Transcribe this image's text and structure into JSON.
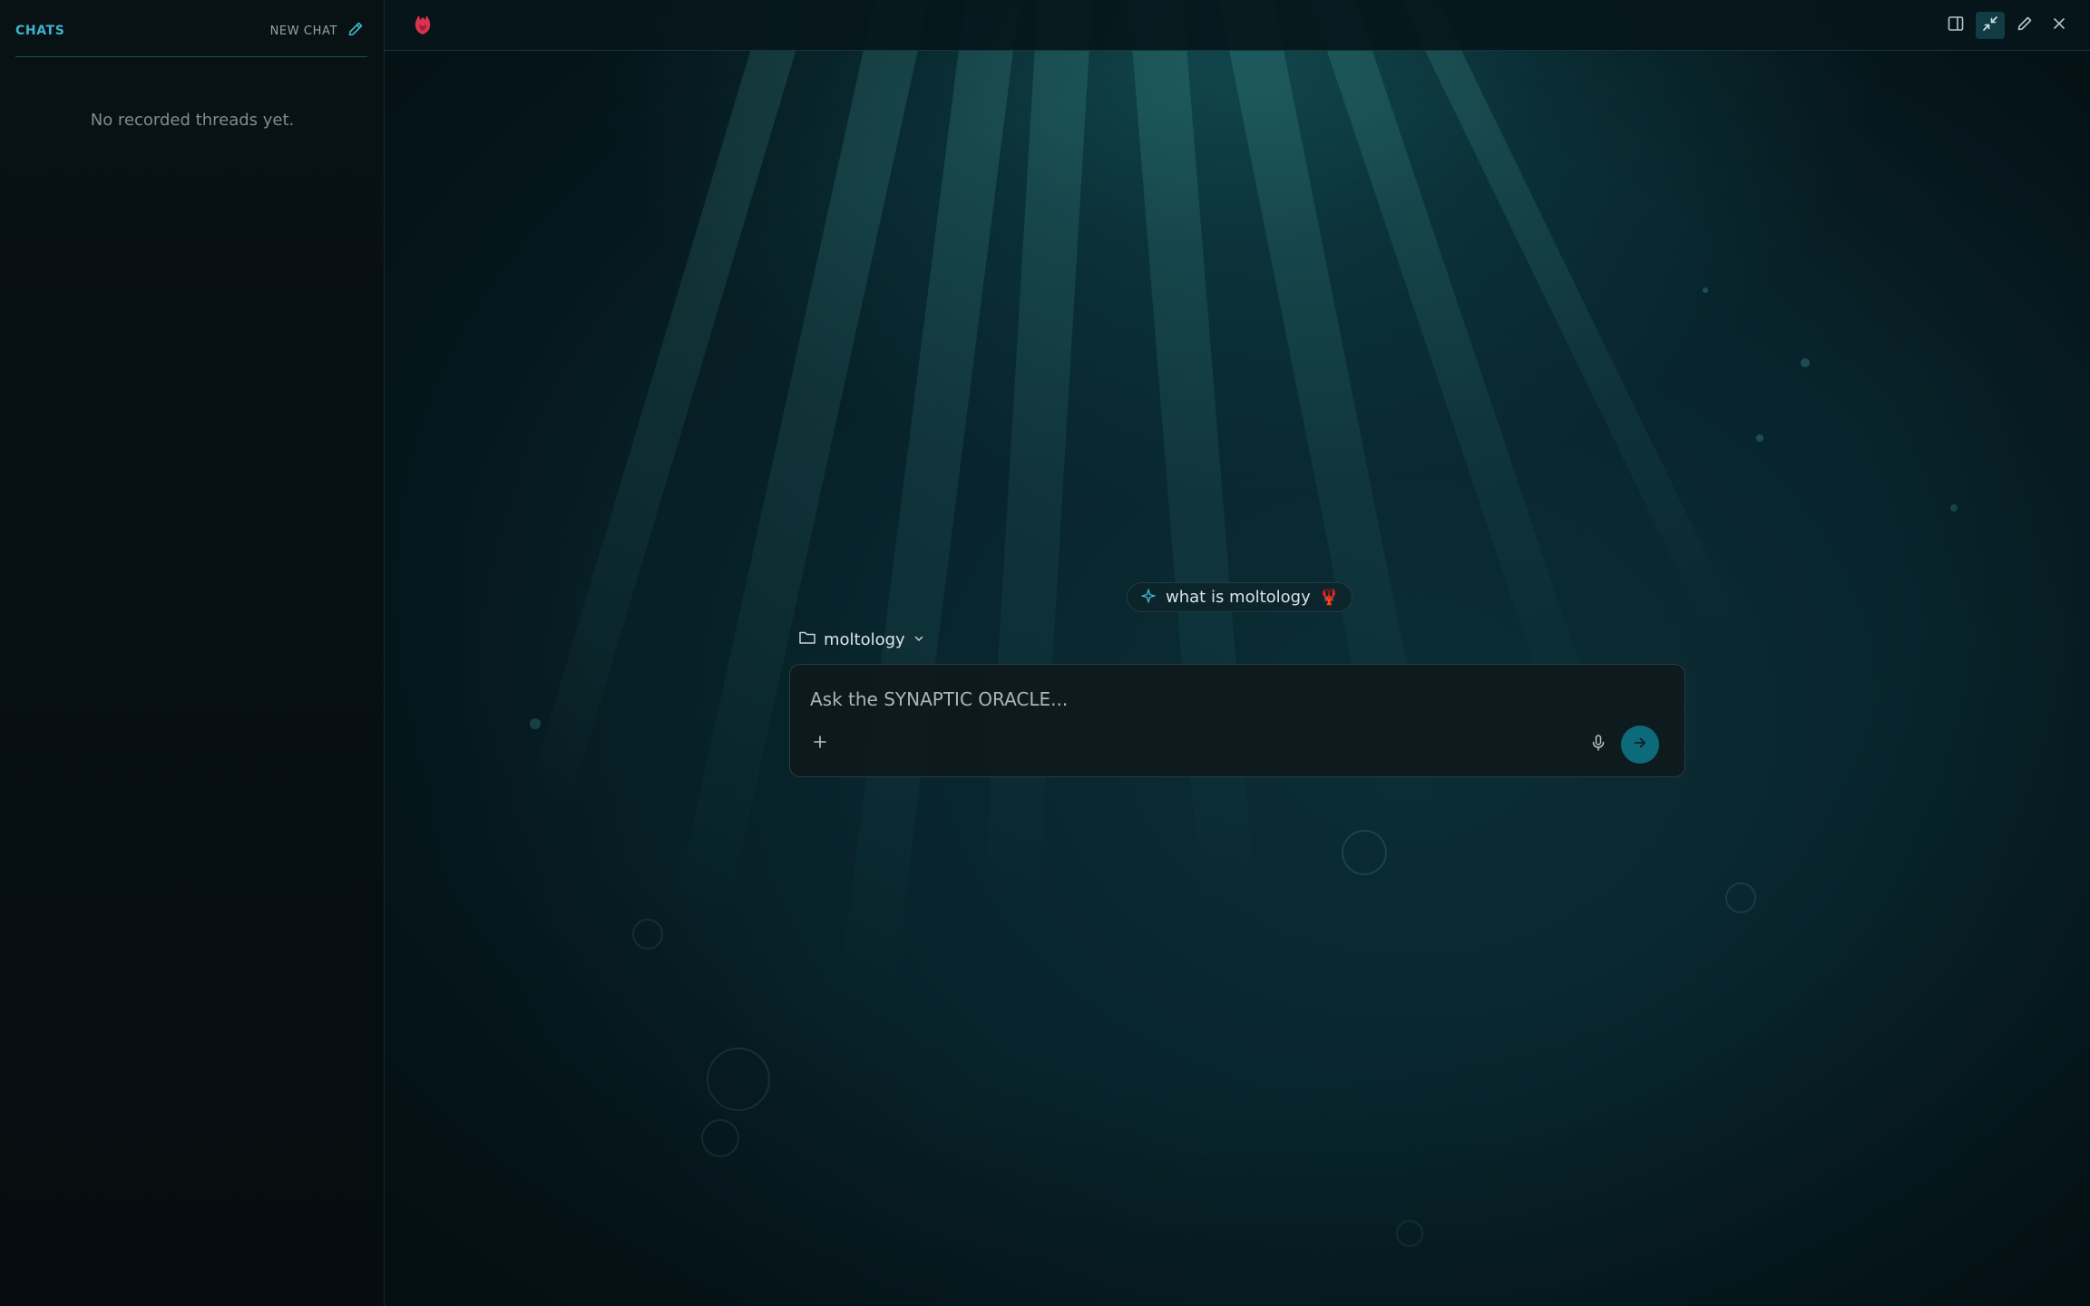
{
  "sidebar": {
    "title": "CHATS",
    "new_chat_label": "NEW CHAT",
    "empty_state": "No recorded threads yet."
  },
  "topbar": {
    "logo_icon": "crab-logo-icon",
    "buttons": [
      {
        "name": "toggle-sidebar",
        "icon": "sidebar-panel-icon"
      },
      {
        "name": "collapse",
        "icon": "collapse-arrows-icon"
      },
      {
        "name": "edit",
        "icon": "pencil-icon"
      },
      {
        "name": "close",
        "icon": "close-icon"
      }
    ]
  },
  "suggestion": {
    "text": "what is moltology",
    "emoji": "🦞"
  },
  "folder": {
    "name": "moltology"
  },
  "composer": {
    "placeholder": "Ask the SYNAPTIC ORACLE...",
    "value": ""
  },
  "colors": {
    "accent": "#3fb3cc",
    "send_button": "#0d6a7a",
    "logo": "#d8334f"
  }
}
